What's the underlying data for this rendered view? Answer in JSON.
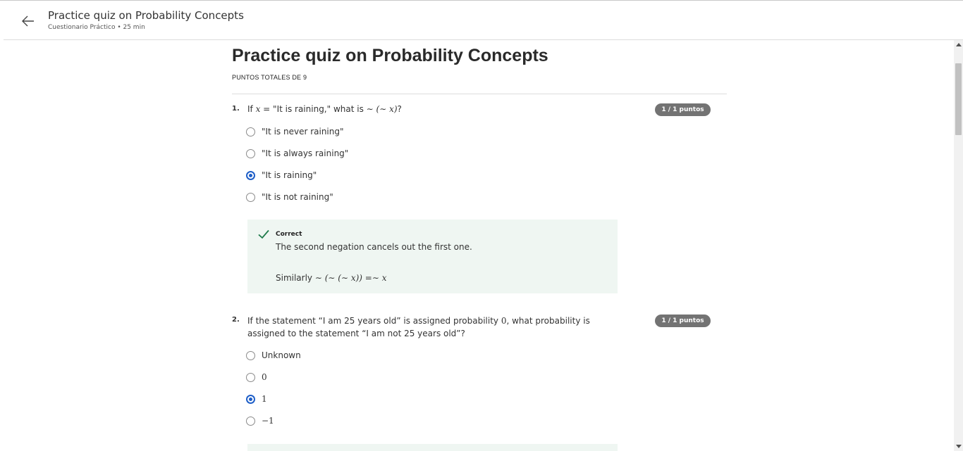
{
  "header": {
    "title": "Practice quiz on Probability Concepts",
    "subtitle": "Cuestionario Práctico • 25 min",
    "back_icon": "arrow-left-icon"
  },
  "page": {
    "title": "Practice quiz on Probability Concepts",
    "total_points": "PUNTOS TOTALES DE 9"
  },
  "questions": [
    {
      "number": "1.",
      "text_before": "If ",
      "math_1": "x",
      "text_mid": " = \"It is raining,\" what is ",
      "math_2": "∼ (∼ x)",
      "text_after": "?",
      "badge": "1 / 1 puntos",
      "options": [
        {
          "label": "\"It is never raining\"",
          "selected": false
        },
        {
          "label": "\"It is always raining\"",
          "selected": false
        },
        {
          "label": "\"It is raining\"",
          "selected": true
        },
        {
          "label": "\"It is not raining\"",
          "selected": false
        }
      ],
      "feedback": {
        "title": "Correct",
        "text": "The second negation cancels out the first one.",
        "similar_prefix": "Similarly ",
        "similar_math": "∼ (∼ (∼ x)) =∼ x"
      }
    },
    {
      "number": "2.",
      "text_before": "If the statement “I am 25 years old” is assigned probability ",
      "math_1": "0",
      "text_after": ", what probability is assigned to the statement “I am not 25 years old”?",
      "badge": "1 / 1 puntos",
      "options": [
        {
          "label": "Unknown",
          "selected": false
        },
        {
          "label": "0",
          "selected": false
        },
        {
          "label": "1",
          "selected": true
        },
        {
          "label": "−1",
          "selected": false
        }
      ]
    }
  ],
  "colors": {
    "accent": "#1f5fc8",
    "feedback_bg": "#eff6f2",
    "check": "#1e7a4a",
    "badge_bg": "#737373"
  }
}
